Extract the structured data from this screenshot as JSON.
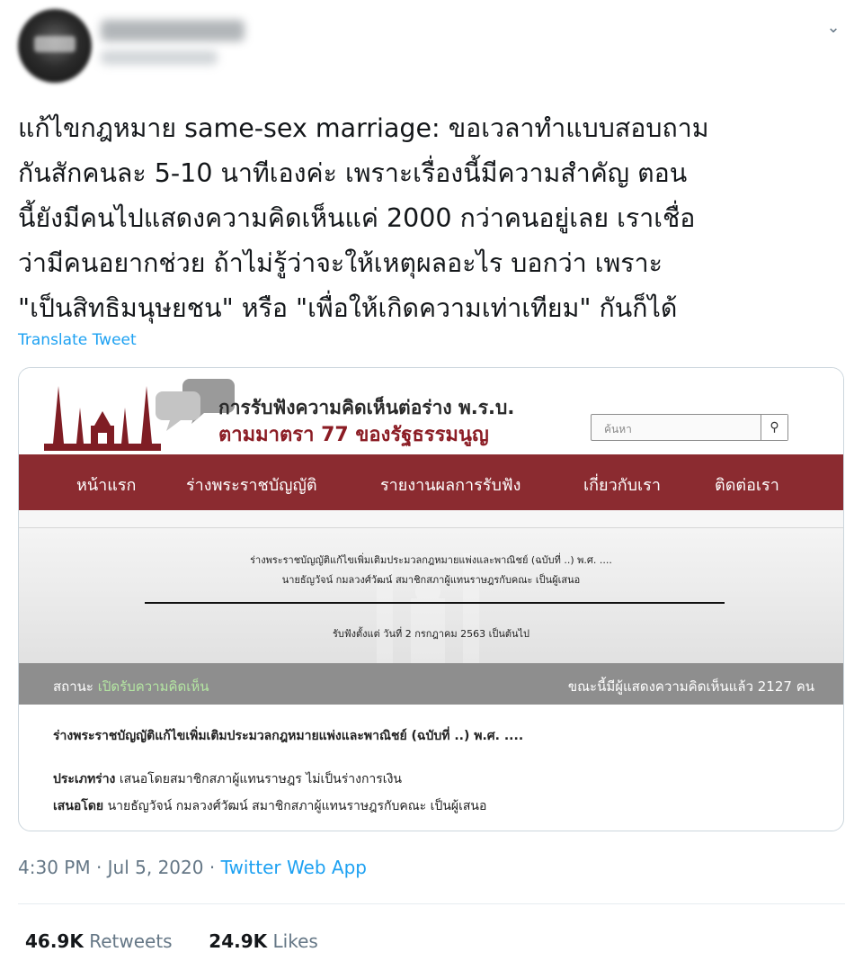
{
  "tweet": {
    "text": "แก้ไขกฎหมาย same-sex marriage: ขอเวลาทำแบบสอบถาม\nกันสักคนละ 5-10 นาทีเองค่ะ เพราะเรื่องนี้มีความสำคัญ ตอน\nนี้ยังมีคนไปแสดงความคิดเห็นแค่ 2000 กว่าคนอยู่เลย เราเชื่อ\nว่ามีคนอยากช่วย ถ้าไม่รู้ว่าจะให้เหตุผลอะไร บอกว่า เพราะ\n\"เป็นสิทธิมนุษยชน\" หรือ \"เพื่อให้เกิดความเท่าเทียม\" กันก็ได้",
    "translate_label": "Translate Tweet",
    "time": "4:30 PM · Jul 5, 2020 · ",
    "app": "Twitter Web App",
    "retweets": "46.9K",
    "retweets_label": "Retweets",
    "likes": "24.9K",
    "likes_label": "Likes"
  },
  "card": {
    "site_title1": "การรับฟังความคิดเห็นต่อร่าง พ.ร.บ.",
    "site_title2": "ตามมาตรา 77 ของรัฐธรรมนูญ",
    "search_placeholder": "ค้นหา",
    "nav": [
      "หน้าแรก",
      "ร่างพระราชบัญญัติ",
      "รายงานผลการรับฟัง",
      "เกี่ยวกับเรา",
      "ติดต่อเรา"
    ],
    "banner_line1": "ร่างพระราชบัญญัติแก้ไขเพิ่มเติมประมวลกฎหมายแพ่งและพาณิชย์ (ฉบับที่ ..) พ.ศ. ....",
    "banner_line2": "นายธัญวัจน์ กมลวงศ์วัฒน์ สมาชิกสภาผู้แทนราษฎรกับคณะ เป็นผู้เสนอ",
    "banner_line3": "รับฟังตั้งแต่ วันที่ 2 กรกฎาคม 2563 เป็นต้นไป",
    "status_label": "สถานะ ",
    "status_value": "เปิดรับความคิดเห็น",
    "status_count": "ขณะนี้มีผู้แสดงความคิดเห็นแล้ว 2127 คน",
    "detail_title": "ร่างพระราชบัญญัติแก้ไขเพิ่มเติมประมวลกฎหมายแพ่งและพาณิชย์ (ฉบับที่ ..) พ.ศ. ....",
    "detail_type_label": "ประเภทร่าง",
    "detail_type_value": " เสนอโดยสมาชิกสภาผู้แทนราษฎร ไม่เป็นร่างการเงิน",
    "detail_by_label": "เสนอโดย",
    "detail_by_value": " นายธัญวัจน์ กมลวงศ์วัฒน์ สมาชิกสภาผู้แทนราษฎรกับคณะ เป็นผู้เสนอ"
  },
  "icons": {
    "menu": "chevron-down-icon",
    "search": "magnifier-icon"
  },
  "colors": {
    "nav_bg": "#8b2b30",
    "link": "#1da1f2",
    "status_value": "#b4e6a2"
  }
}
